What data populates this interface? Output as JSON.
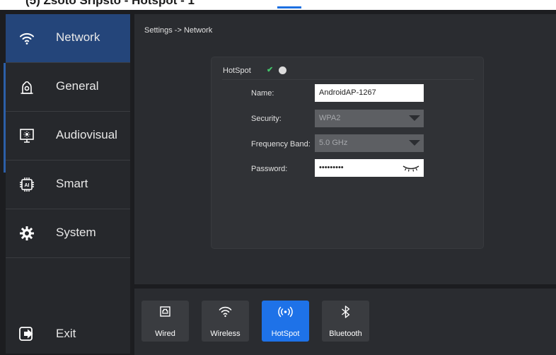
{
  "caption": {
    "text": "(5) Zsoto Sripsto - Hotspot - 1"
  },
  "sidebar": {
    "items": [
      {
        "label": "Network",
        "icon": "wifi-icon",
        "active": true
      },
      {
        "label": "General",
        "icon": "general-icon",
        "active": false
      },
      {
        "label": "Audiovisual",
        "icon": "monitor-icon",
        "active": false
      },
      {
        "label": "Smart",
        "icon": "ai-chip-icon",
        "active": false
      },
      {
        "label": "System",
        "icon": "gear-icon",
        "active": false
      }
    ],
    "exit": {
      "label": "Exit",
      "icon": "exit-icon"
    }
  },
  "content": {
    "breadcrumb": "Settings -> Network",
    "hotspot": {
      "title": "HotSpot",
      "toggle_on": true,
      "fields": {
        "name": {
          "label": "Name:",
          "value": "AndroidAP-1267"
        },
        "security": {
          "label": "Security:",
          "value": "WPA2"
        },
        "frequency": {
          "label": "Frequency Band:",
          "value": "5.0 GHz"
        },
        "password": {
          "label": "Password:",
          "value": "•••••••••"
        }
      }
    }
  },
  "tabs": [
    {
      "label": "Wired",
      "icon": "ethernet-icon",
      "active": false
    },
    {
      "label": "Wireless",
      "icon": "wifi-icon",
      "active": false
    },
    {
      "label": "HotSpot",
      "icon": "hotspot-icon",
      "active": true
    },
    {
      "label": "Bluetooth",
      "icon": "bluetooth-icon",
      "active": false
    }
  ],
  "colors": {
    "accent": "#1e72e8",
    "sidebar_active": "#24457a",
    "background": "#1c1d20",
    "toggle_check": "#43c56a"
  }
}
